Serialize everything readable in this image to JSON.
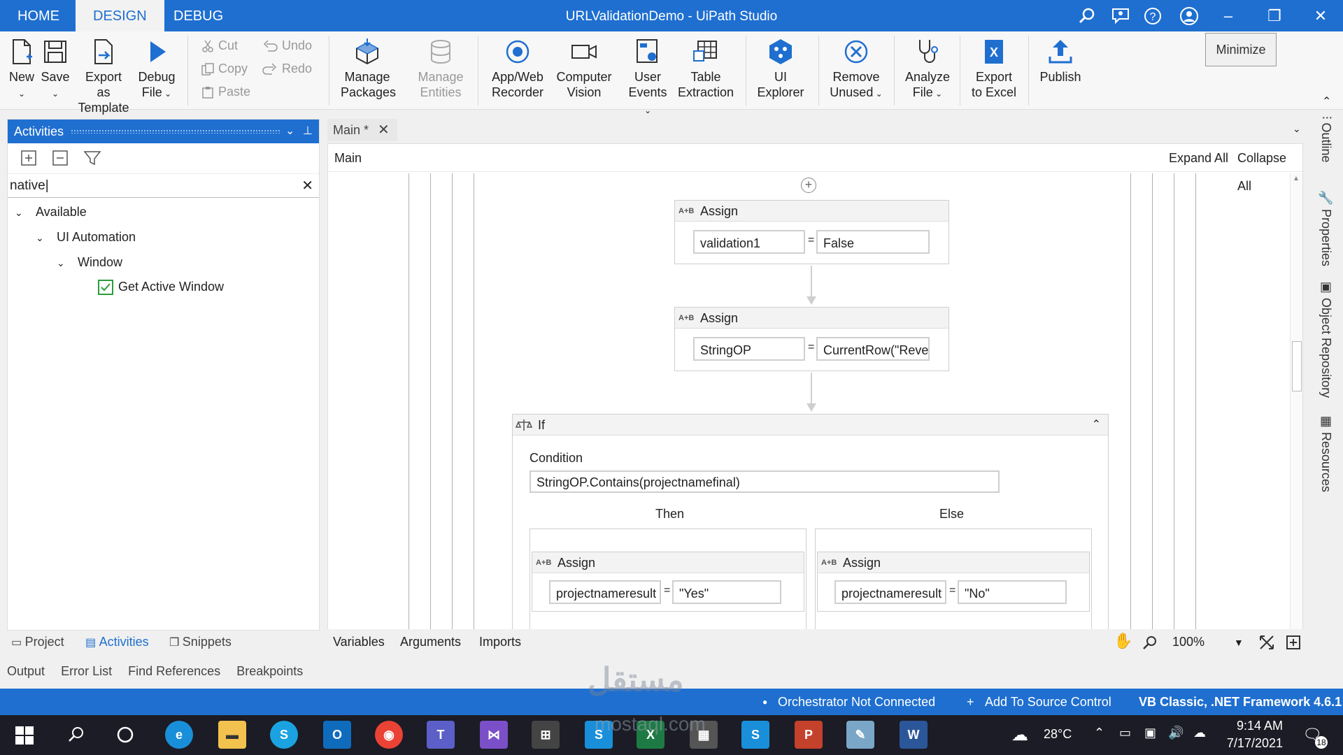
{
  "titlebar": {
    "tabs": [
      "HOME",
      "DESIGN",
      "DEBUG"
    ],
    "active_tab": "DESIGN",
    "title": "URLValidationDemo - UiPath Studio",
    "window_buttons": {
      "minimize": "–",
      "restore": "❐",
      "close": "✕"
    }
  },
  "ribbon": {
    "new": "New",
    "save": "Save",
    "export_template_1": "Export as",
    "export_template_2": "Template",
    "debug_1": "Debug",
    "debug_2": "File",
    "cut": "Cut",
    "copy": "Copy",
    "paste": "Paste",
    "undo": "Undo",
    "redo": "Redo",
    "manage_packages_1": "Manage",
    "manage_packages_2": "Packages",
    "manage_entities_1": "Manage",
    "manage_entities_2": "Entities",
    "recorder_1": "App/Web",
    "recorder_2": "Recorder",
    "cv_1": "Computer",
    "cv_2": "Vision",
    "user_events_1": "User",
    "user_events_2": "Events",
    "table_1": "Table",
    "table_2": "Extraction",
    "ui_explorer_1": "UI",
    "ui_explorer_2": "Explorer",
    "remove_1": "Remove",
    "remove_2": "Unused",
    "analyze_1": "Analyze",
    "analyze_2": "File",
    "export_excel_1": "Export",
    "export_excel_2": "to Excel",
    "publish": "Publish",
    "tooltip": "Minimize"
  },
  "activities_panel": {
    "title": "Activities",
    "search_value": "native",
    "tree": [
      "Available",
      "UI Automation",
      "Window",
      "Get Active Window"
    ]
  },
  "left_bottom_tabs": [
    "Project",
    "Activities",
    "Snippets"
  ],
  "output_tabs": [
    "Output",
    "Error List",
    "Find References",
    "Breakpoints"
  ],
  "designer": {
    "doc_tab": "Main *",
    "breadcrumb": "Main",
    "expand_all": "Expand All",
    "collapse_all": "Collapse All",
    "assign1": {
      "title": "Assign",
      "to": "validation1",
      "value": "False"
    },
    "assign2": {
      "title": "Assign",
      "to": "StringOP",
      "value": "CurrentRow(\"Rever"
    },
    "if_block": {
      "title": "If",
      "condition_label": "Condition",
      "condition": "StringOP.Contains(projectnamefinal)",
      "then_label": "Then",
      "else_label": "Else",
      "then_assign": {
        "title": "Assign",
        "to": "projectnameresult",
        "value": "\"Yes\""
      },
      "else_assign": {
        "title": "Assign",
        "to": "projectnameresult",
        "value": "\"No\""
      }
    },
    "bottom_tabs": [
      "Variables",
      "Arguments",
      "Imports"
    ],
    "zoom": "100%"
  },
  "right_rail": [
    "Outline",
    "Properties",
    "Object Repository",
    "Resources"
  ],
  "statusbar": {
    "orchestrator": "Orchestrator Not Connected",
    "source_control": "Add To Source Control",
    "framework": "VB Classic, .NET Framework 4.6.1"
  },
  "taskbar": {
    "temperature": "28°C",
    "time": "9:14 AM",
    "date": "7/17/2021",
    "notifications": "18"
  },
  "watermark": {
    "text_ar": "مستقل",
    "text_en": "mostaql.com"
  }
}
